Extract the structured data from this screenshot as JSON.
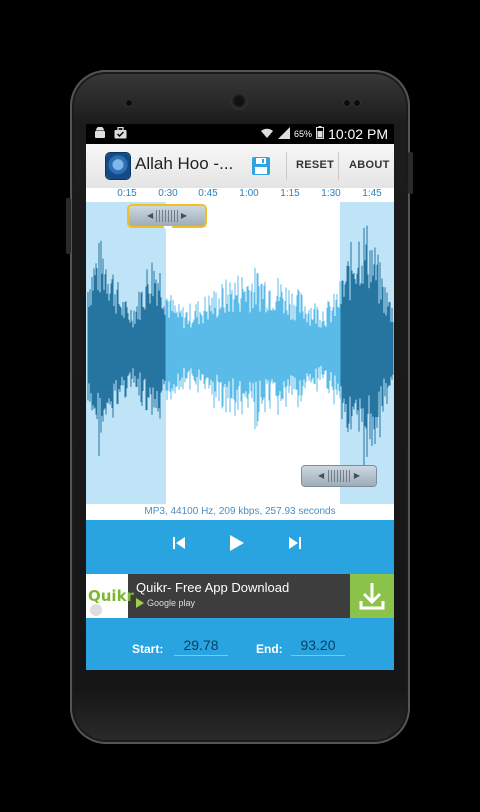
{
  "statusbar": {
    "battery": "65%",
    "time": "10:02 PM"
  },
  "actionbar": {
    "title": "Allah Hoo -...",
    "reset_label": "RESET",
    "about_label": "ABOUT"
  },
  "timeline": {
    "ticks": [
      "0:15",
      "0:30",
      "0:45",
      "1:00",
      "1:15",
      "1:30",
      "1:45"
    ]
  },
  "info_text": "MP3, 44100 Hz, 209 kbps, 257.93 seconds",
  "ad": {
    "title": "Quikr- Free App Download",
    "subtitle": "Google play",
    "logo_text": "Quikr"
  },
  "start": {
    "label": "Start:",
    "value": "29.78"
  },
  "end": {
    "label": "End:",
    "value": "93.20"
  },
  "colors": {
    "accent": "#29a4e0",
    "wave_dark": "#1e6f9c",
    "wave_light": "#3fb0e4",
    "selection_shade": "#bfe3f7",
    "ad_green": "#8bc34a"
  }
}
